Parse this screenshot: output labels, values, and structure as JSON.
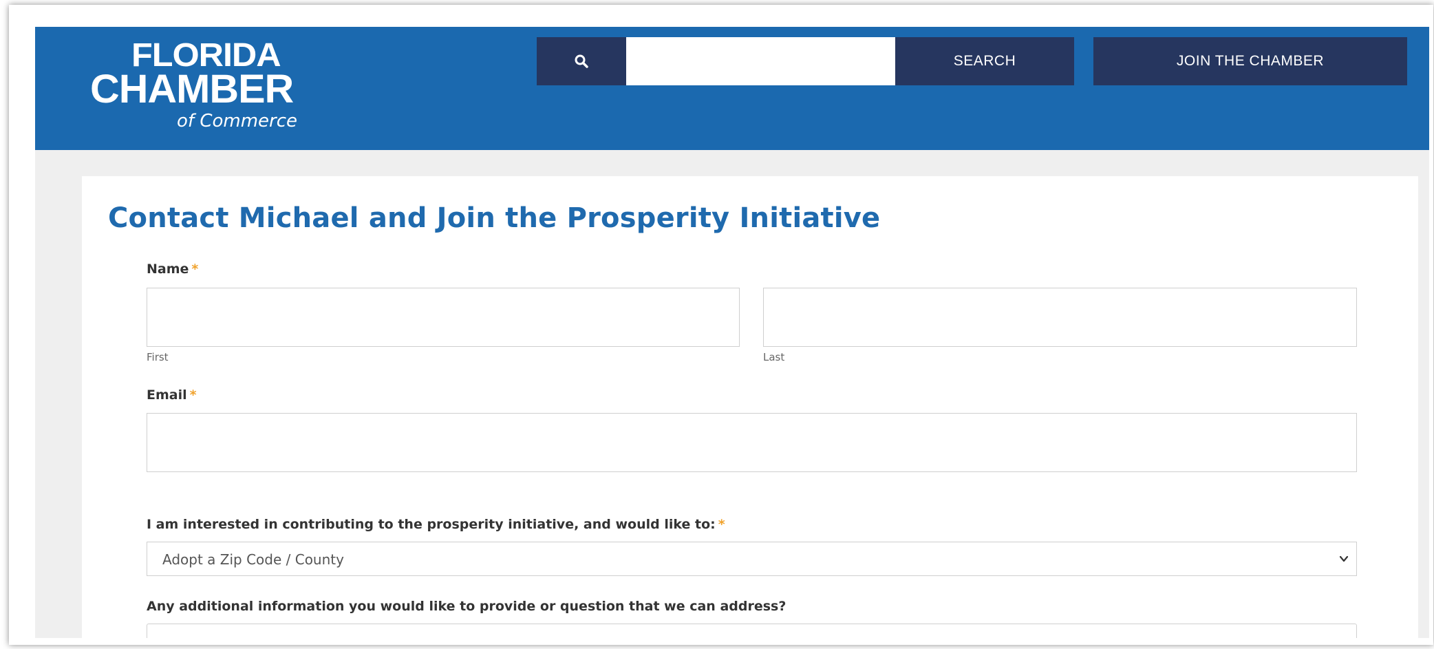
{
  "header": {
    "logo": {
      "line1": "FLORIDA",
      "line2": "CHAMBER",
      "line3": "of Commerce"
    },
    "search": {
      "icon": "search-icon",
      "placeholder": "",
      "value": "",
      "button_label": "SEARCH"
    },
    "join_label": "JOIN THE CHAMBER",
    "colors": {
      "header_bg": "#1b69af",
      "button_bg": "#26365f"
    }
  },
  "form": {
    "title": "Contact Michael and Join the Prosperity Initiative",
    "required_marker": "*",
    "name": {
      "label": "Name",
      "first_label": "First",
      "last_label": "Last",
      "first_value": "",
      "last_value": ""
    },
    "email": {
      "label": "Email",
      "value": ""
    },
    "interest": {
      "label": "I am interested in contributing to the prosperity initiative, and would like to:",
      "selected": "Adopt a Zip Code / County"
    },
    "additional": {
      "label": "Any additional information you would like to provide or question that we can address?",
      "value": ""
    },
    "colors": {
      "title": "#1f6aae",
      "required": "#f0a22c"
    }
  }
}
